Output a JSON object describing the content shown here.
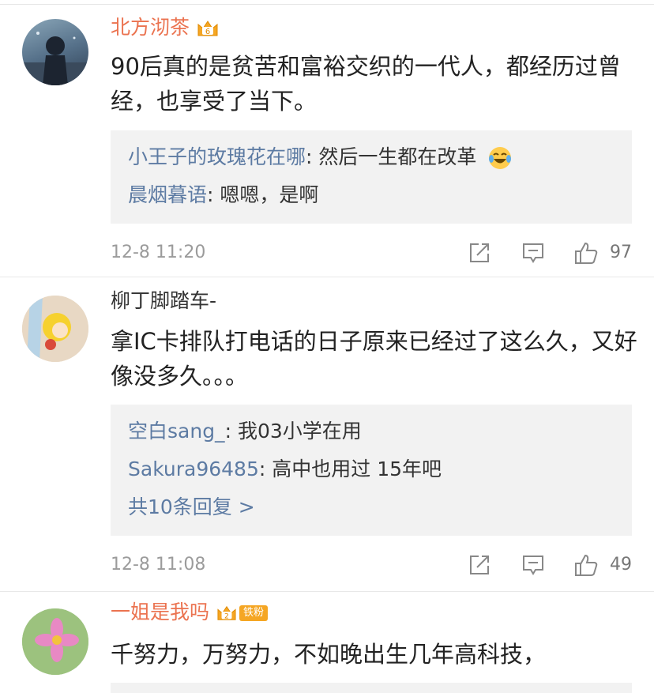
{
  "comments": [
    {
      "username": "北方沏茶",
      "text": "90后真的是贫苦和富裕交织的一代人，都经历过曾经，也享受了当下。",
      "replies": [
        {
          "name": "小王子的玫瑰花在哪",
          "sep": ": ",
          "content": "然后一生都在改革",
          "emoji": "laughing-tears"
        },
        {
          "name": "晨烟暮语",
          "sep": ": ",
          "content": "嗯嗯，是啊"
        }
      ],
      "time": "12-8 11:20",
      "likes": "97"
    },
    {
      "username": "柳丁脚踏车-",
      "text": "拿IC卡排队打电话的日子原来已经过了这么久，又好像没多久。。。",
      "replies": [
        {
          "name": "空白sang_",
          "sep": ": ",
          "content": "我03小学在用"
        },
        {
          "name": "Sakura96485",
          "sep": ": ",
          "content": "高中也用过  15年吧"
        }
      ],
      "more_replies": "共10条回复 >",
      "time": "12-8 11:08",
      "likes": "49"
    },
    {
      "username": "一姐是我吗",
      "badge_text": "铁粉",
      "text": "千努力，万努力，不如晚出生几年高科技，"
    }
  ],
  "icons": {
    "repost": "share-arrow-icon",
    "comment": "comment-bubble-icon",
    "like": "thumbs-up-icon",
    "vip": "crown-badge-icon"
  },
  "colors": {
    "vip_name": "#eb7350",
    "reply_name": "#5d7ba3",
    "reply_bg": "#f2f2f2",
    "meta": "#9b9b9b"
  }
}
